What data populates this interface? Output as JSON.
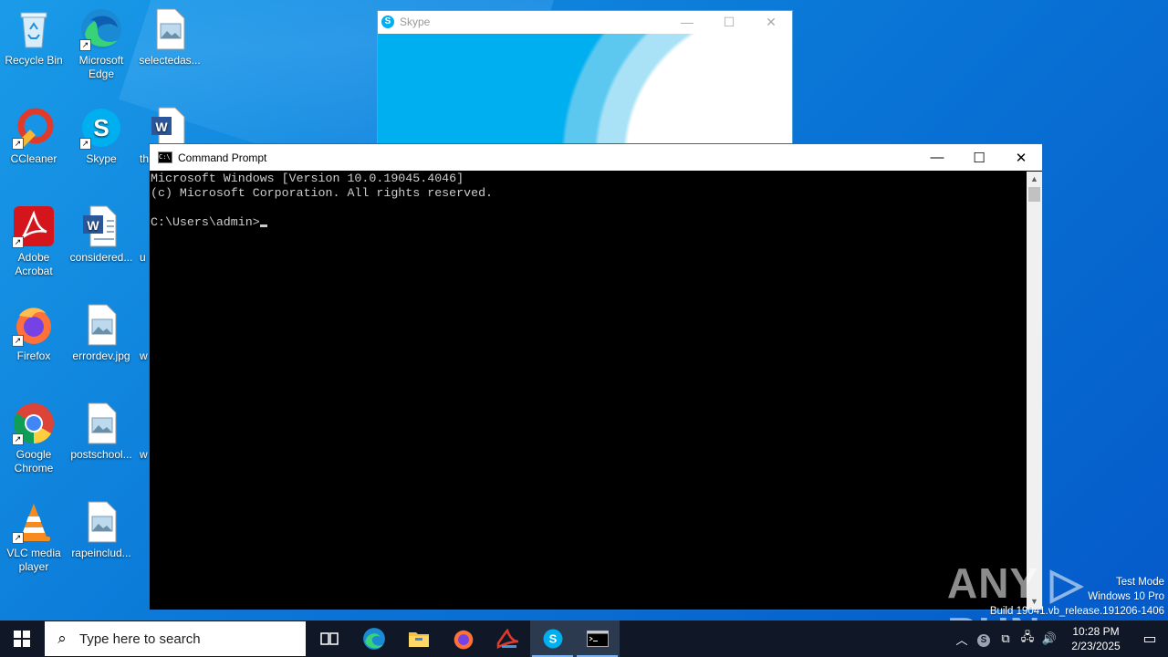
{
  "desktop": {
    "icons": [
      {
        "label": "Recycle Bin"
      },
      {
        "label": "Microsoft Edge"
      },
      {
        "label": "selectedas..."
      },
      {
        "label": "CCleaner"
      },
      {
        "label": "Skype"
      },
      {
        "label": "th"
      },
      {
        "label": "Adobe Acrobat"
      },
      {
        "label": "considered..."
      },
      {
        "label": "u"
      },
      {
        "label": "Firefox"
      },
      {
        "label": "errordev.jpg"
      },
      {
        "label": "w"
      },
      {
        "label": "Google Chrome"
      },
      {
        "label": "postschool..."
      },
      {
        "label": "w"
      },
      {
        "label": "VLC media player"
      },
      {
        "label": "rapeinclud..."
      }
    ]
  },
  "skype_window": {
    "title": "Skype",
    "minimize": "—",
    "maximize": "☐",
    "close": "✕"
  },
  "cmd_window": {
    "title": "Command Prompt",
    "minimize": "—",
    "maximize": "☐",
    "close": "✕",
    "lines": [
      "Microsoft Windows [Version 10.0.19045.4046]",
      "(c) Microsoft Corporation. All rights reserved.",
      "",
      "C:\\Users\\admin>"
    ]
  },
  "watermark": {
    "line1": "Test Mode",
    "line2": "Windows 10 Pro",
    "line3": "Build 19041.vb_release.191206-1406",
    "brand": "ANY RUN"
  },
  "taskbar": {
    "search_placeholder": "Type here to search",
    "pinned": [
      {
        "name": "task-view-icon"
      },
      {
        "name": "edge-icon"
      },
      {
        "name": "file-explorer-icon"
      },
      {
        "name": "firefox-icon"
      },
      {
        "name": "acrobat-icon"
      },
      {
        "name": "skype-icon"
      },
      {
        "name": "command-prompt-icon"
      }
    ],
    "time": "10:28 PM",
    "date": "2/23/2025"
  },
  "colors": {
    "desktop_blue": "#0a78d7",
    "taskbar": "#101828",
    "skype_blue": "#00aff0",
    "console_bg": "#000000",
    "console_text": "#cccccc"
  }
}
